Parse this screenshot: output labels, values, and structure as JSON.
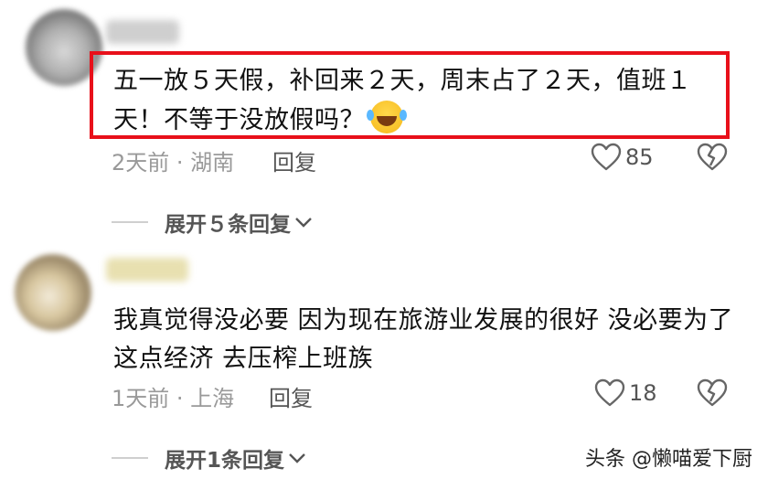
{
  "comments": [
    {
      "text": "五一放５天假，补回来２天，周末占了２天，值班１天！不等于没放假吗？",
      "emoji": "laughing-crying-emoji",
      "time_location": "2天前 · 湖南",
      "reply_label": "回复",
      "like_count": "85",
      "expand_label": "展开５条回复"
    },
    {
      "text": "我真觉得没必要  因为现在旅游业发展的很好  没必要为了这点经济  去压榨上班族",
      "time_location": "1天前 · 上海",
      "reply_label": "回复",
      "like_count": "18",
      "expand_label": "展开1条回复"
    }
  ],
  "watermark": "头条 @懒喵爱下厨",
  "colors": {
    "highlight_border": "#e8101a",
    "meta_text": "#999999",
    "body_text": "#111111"
  }
}
